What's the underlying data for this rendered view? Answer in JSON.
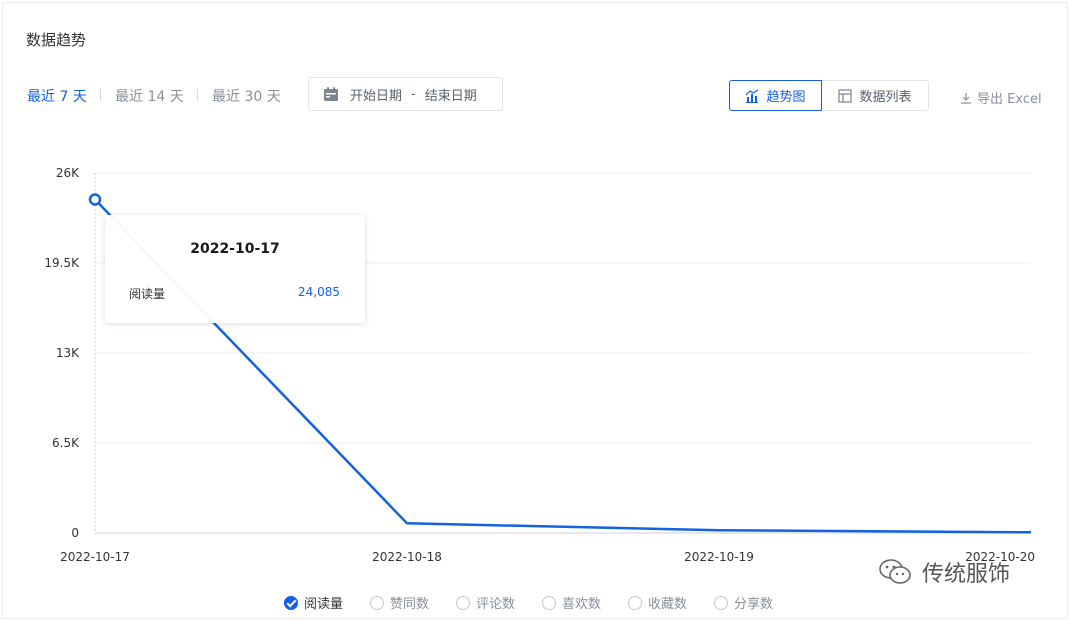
{
  "section_title": "数据趋势",
  "ranges": [
    "最近 7 天",
    "最近 14 天",
    "最近 30 天"
  ],
  "date_picker": {
    "start": "开始日期",
    "separator": "-",
    "end": "结束日期"
  },
  "view_toggle": {
    "trend_label": "趋势图",
    "list_label": "数据列表"
  },
  "export_label": "导出 Excel",
  "tooltip": {
    "date": "2022-10-17",
    "label": "阅读量",
    "value": "24,085"
  },
  "legend": [
    {
      "label": "阅读量",
      "checked": true
    },
    {
      "label": "赞同数",
      "checked": false
    },
    {
      "label": "评论数",
      "checked": false
    },
    {
      "label": "喜欢数",
      "checked": false
    },
    {
      "label": "收藏数",
      "checked": false
    },
    {
      "label": "分享数",
      "checked": false
    }
  ],
  "watermark": "传统服饰",
  "colors": {
    "accent": "#1561e6",
    "grid": "#eeeeee",
    "axis": "#cfd2d8"
  },
  "chart_data": {
    "type": "line",
    "x": [
      "2022-10-17",
      "2022-10-18",
      "2022-10-19",
      "2022-10-20"
    ],
    "series": [
      {
        "name": "阅读量",
        "values": [
          24085,
          700,
          200,
          50
        ]
      }
    ],
    "y_ticks": [
      "0",
      "6.5K",
      "13K",
      "19.5K",
      "26K"
    ],
    "ylim": [
      0,
      26000
    ],
    "grid": true,
    "highlighted_index": 0
  }
}
